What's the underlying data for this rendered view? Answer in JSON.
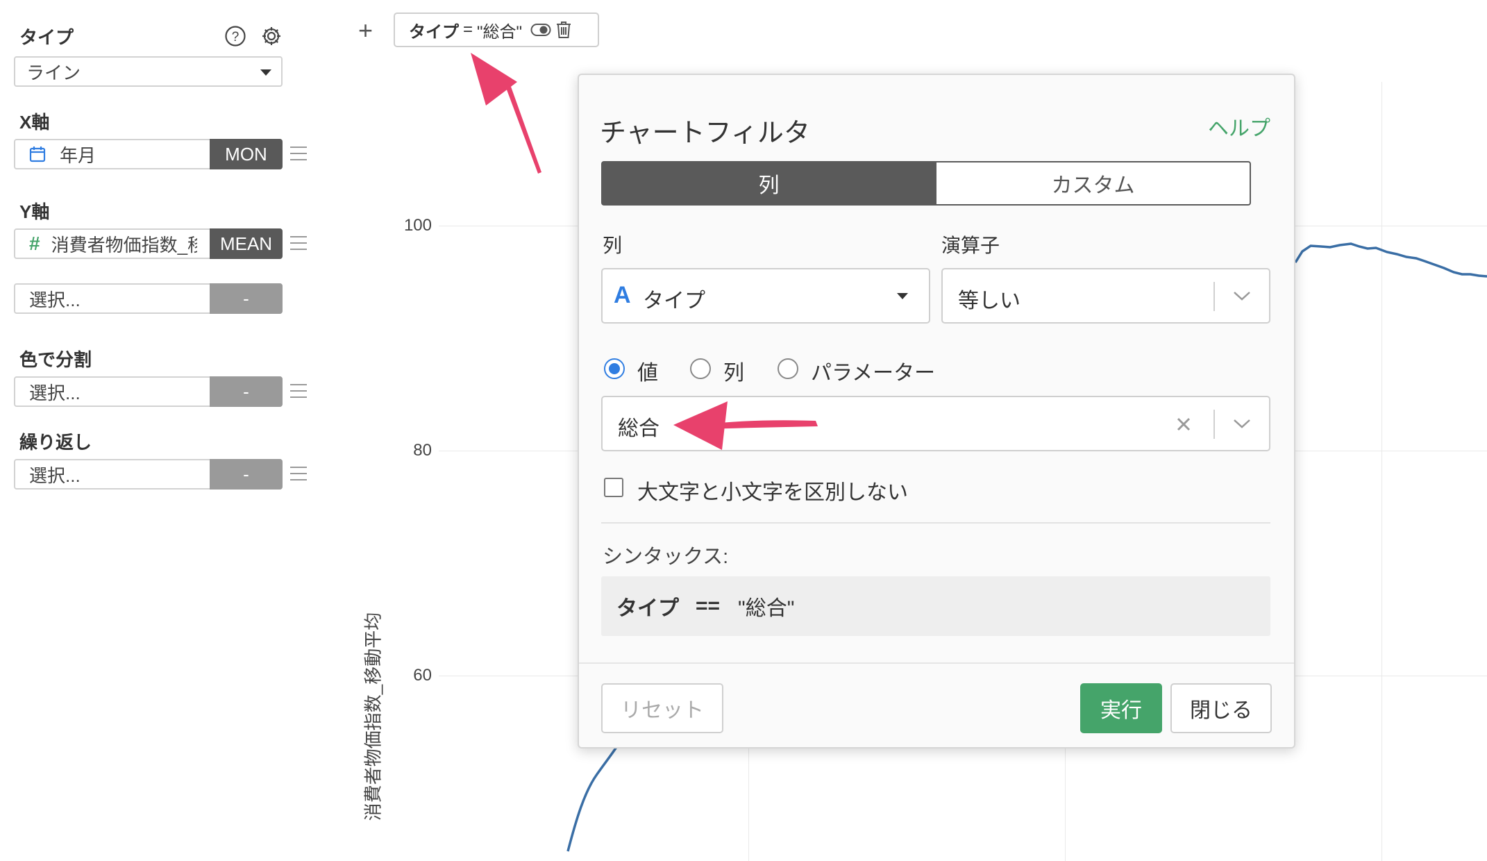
{
  "left_panel": {
    "type_label": "タイプ",
    "type_value": "ライン",
    "x_axis_label": "X軸",
    "x_field": "年月",
    "x_agg": "MON",
    "y_axis_label": "Y軸",
    "y_field": "消費者物価指数_移",
    "y_agg": "MEAN",
    "y2_placeholder": "選択...",
    "y2_agg": "-",
    "color_label": "色で分割",
    "color_placeholder": "選択...",
    "color_agg": "-",
    "repeat_label": "繰り返し",
    "repeat_placeholder": "選択...",
    "repeat_agg": "-"
  },
  "chart": {
    "ylabel": "消費者物価指数_移動平均",
    "yticks": [
      "100",
      "80",
      "60"
    ],
    "line_color": "#3a6ea5"
  },
  "filter_chip": {
    "name": "タイプ",
    "op": "=",
    "value": "\"総合\""
  },
  "dialog": {
    "title": "チャートフィルタ",
    "help": "ヘルプ",
    "tab_column": "列",
    "tab_custom": "カスタム",
    "column_label": "列",
    "column_value": "タイプ",
    "operator_label": "演算子",
    "operator_value": "等しい",
    "radio_value": "値",
    "radio_column": "列",
    "radio_parameter": "パラメーター",
    "value_input": "総合",
    "case_insensitive": "大文字と小文字を区別しない",
    "syntax_label": "シンタックス:",
    "syntax_field": "タイプ",
    "syntax_op": "==",
    "syntax_value": "\"総合\"",
    "reset": "リセット",
    "run": "実行",
    "close": "閉じる"
  },
  "colors": {
    "accent_green": "#45a46a",
    "tab_active": "#5a5a5a",
    "radio_blue": "#2f7de1",
    "annotation_pink": "#e8416c"
  }
}
